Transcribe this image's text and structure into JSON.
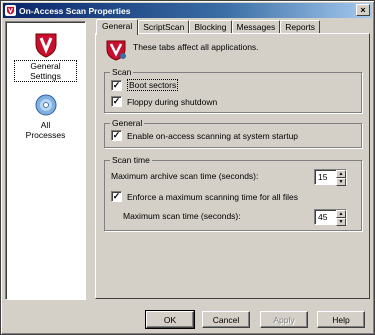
{
  "window": {
    "title": "On-Access Scan Properties",
    "close_glyph": "×"
  },
  "nav": [
    {
      "label_line1": "General",
      "label_line2": "Settings",
      "icon": "shield-v-icon",
      "selected": true
    },
    {
      "label_line1": "All",
      "label_line2": "Processes",
      "icon": "cd-disc-icon",
      "selected": false
    }
  ],
  "tabs": [
    {
      "label": "General",
      "active": true
    },
    {
      "label": "ScriptScan",
      "active": false
    },
    {
      "label": "Blocking",
      "active": false
    },
    {
      "label": "Messages",
      "active": false
    },
    {
      "label": "Reports",
      "active": false
    }
  ],
  "intro_text": "These tabs affect all applications.",
  "scan_group": {
    "title": "Scan",
    "boot_sectors": {
      "label": "Boot sectors",
      "checked": true
    },
    "floppy": {
      "label": "Floppy during shutdown",
      "checked": true
    }
  },
  "general_group": {
    "title": "General",
    "enable_startup": {
      "label": "Enable on-access scanning at system startup",
      "checked": true
    }
  },
  "scantime_group": {
    "title": "Scan time",
    "max_archive_label": "Maximum archive scan time (seconds):",
    "max_archive_value": "15",
    "enforce": {
      "label": "Enforce a maximum scanning time for all files",
      "checked": true
    },
    "max_scan_label": "Maximum scan time (seconds):",
    "max_scan_value": "45"
  },
  "buttons": {
    "ok": "OK",
    "cancel": "Cancel",
    "apply": "Apply",
    "help": "Help"
  },
  "colors": {
    "face": "#d4d0c8",
    "title_start": "#0a246a",
    "title_end": "#a6caf0",
    "shield_red": "#c8102e"
  }
}
